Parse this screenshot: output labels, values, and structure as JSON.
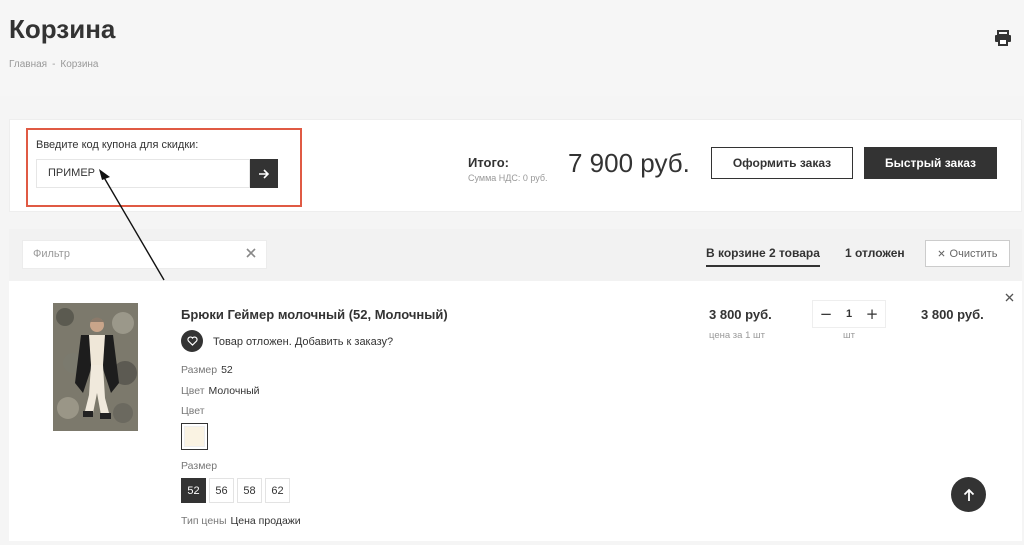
{
  "page": {
    "title": "Корзина",
    "breadcrumb": [
      "Главная",
      "Корзина"
    ],
    "breadcrumb_sep": "-"
  },
  "coupon": {
    "label": "Введите код купона для скидки:",
    "value": "ПРИМЕР"
  },
  "summary": {
    "total_label": "Итого:",
    "vat_label": "Сумма НДС: 0 руб.",
    "total_price": "7 900 руб.",
    "checkout_label": "Оформить заказ",
    "quick_order_label": "Быстрый заказ"
  },
  "filter": {
    "placeholder": "Фильтр",
    "tab_in_cart": "В корзине 2 товара",
    "tab_deferred": "1 отложен",
    "clear_label": "Очистить"
  },
  "item": {
    "title": "Брюки Геймер молочный (52, Молочный)",
    "deferred_text": "Товар отложен. Добавить к заказу?",
    "size_key": "Размер",
    "size_value": "52",
    "color_key": "Цвет",
    "color_value": "Молочный",
    "color_label": "Цвет",
    "swatch_color": "#faf3e3",
    "size_label": "Размер",
    "sizes": [
      "52",
      "56",
      "58",
      "62"
    ],
    "selected_size": "52",
    "price_type_key": "Тип цены",
    "price_type_value": "Цена продажи",
    "unit_price": "3 800 руб.",
    "unit_note": "цена за 1 шт",
    "quantity": "1",
    "quantity_unit": "шт",
    "line_total": "3 800 руб."
  },
  "colors": {
    "dark": "#333333",
    "annotation_red": "#e05a44"
  }
}
